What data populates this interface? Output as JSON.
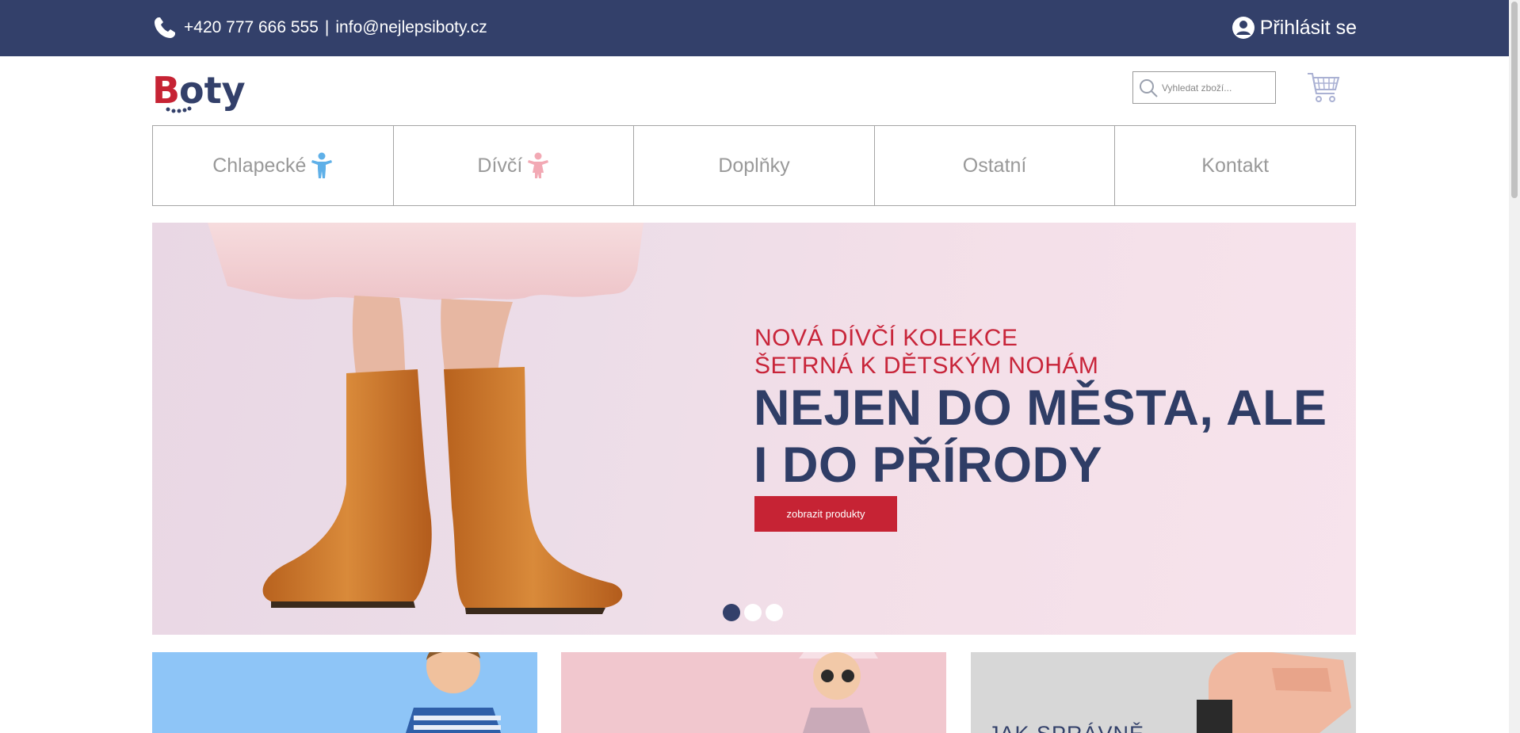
{
  "topbar": {
    "phone": "+420 777 666 555",
    "separator": "|",
    "email": "info@nejlepsiboty.cz",
    "login_label": "Přihlásit se",
    "background": "#33406a"
  },
  "header": {
    "logo_text": "Boty",
    "search": {
      "placeholder": "Vyhledat zboží..."
    },
    "cart_icon": "cart-icon"
  },
  "nav": {
    "items": [
      {
        "label": "Chlapecké",
        "icon": "boy-icon"
      },
      {
        "label": "Dívčí",
        "icon": "girl-icon"
      },
      {
        "label": "Doplňky"
      },
      {
        "label": "Ostatní"
      },
      {
        "label": "Kontakt"
      }
    ]
  },
  "hero": {
    "subtitle_line1": "NOVÁ DÍVČÍ KOLEKCE",
    "subtitle_line2": "ŠETRNÁ K DĚTSKÝM NOHÁM",
    "headline": "NEJEN DO MĚSTA, ALE I DO PŘÍRODY",
    "cta_label": "zobrazit produkty",
    "slides_total": 3,
    "active_slide": 1
  },
  "cards": [
    {
      "color": "#8ec5f7"
    },
    {
      "color": "#f1c7ce"
    },
    {
      "color": "#d7d7d7",
      "text": "JAK SPRÁVNĚ"
    }
  ],
  "colors": {
    "navy": "#33406a",
    "red": "#c62334",
    "nav_text": "#999999"
  }
}
